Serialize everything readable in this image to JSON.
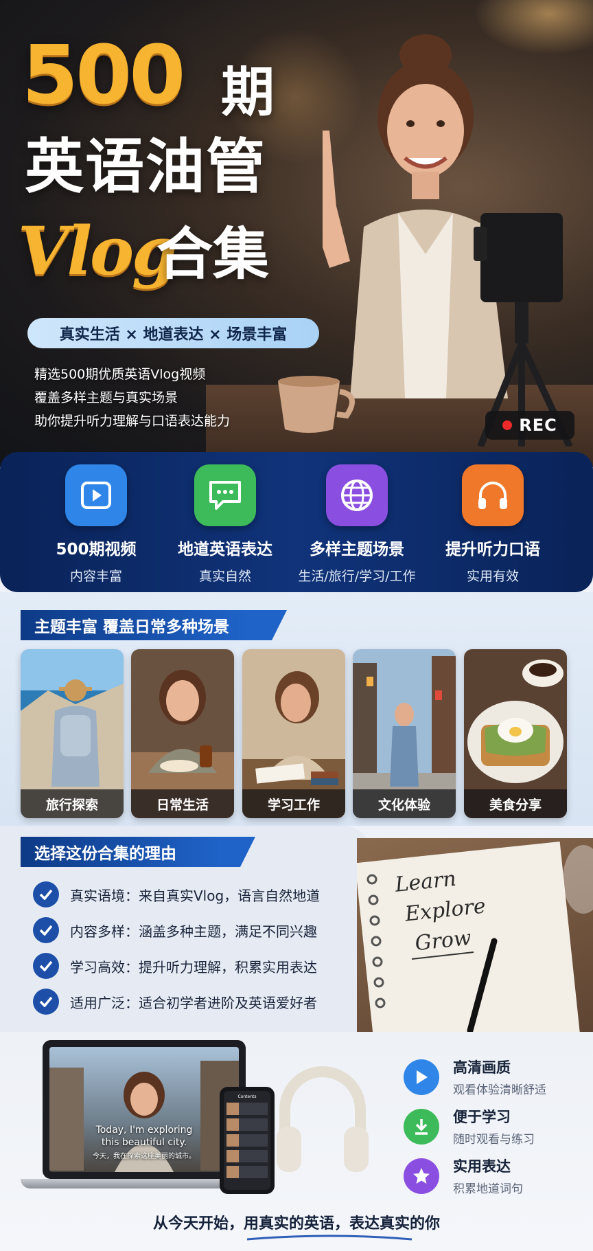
{
  "hero": {
    "title_number": "500",
    "title_unit": "期",
    "title_line2": "英语油管",
    "title_vlog": "Vlog",
    "title_suffix": "合集",
    "tagline": "真实生活 × 地道表达 × 场景丰富",
    "intro": [
      "精选500期优质英语Vlog视频",
      "覆盖多样主题与真实场景",
      "助你提升听力理解与口语表达能力"
    ],
    "rec_label": "REC"
  },
  "features": [
    {
      "title": "500期视频",
      "sub": "内容丰富",
      "icon": "play-icon",
      "color": "#2f86e8"
    },
    {
      "title": "地道英语表达",
      "sub": "真实自然",
      "icon": "chat-bubble-icon",
      "color": "#3dbb5a"
    },
    {
      "title": "多样主题场景",
      "sub": "生活/旅行/学习/工作",
      "icon": "globe-icon",
      "color": "#8a4fe0"
    },
    {
      "title": "提升听力口语",
      "sub": "实用有效",
      "icon": "headphones-icon",
      "color": "#f0782a"
    }
  ],
  "themes": {
    "heading": "主题丰富 覆盖日常多种场景",
    "cards": [
      {
        "label": "旅行探索"
      },
      {
        "label": "日常生活"
      },
      {
        "label": "学习工作"
      },
      {
        "label": "文化体验"
      },
      {
        "label": "美食分享"
      }
    ]
  },
  "reasons": {
    "heading": "选择这份合集的理由",
    "items": [
      "真实语境：来自真实Vlog，语言自然地道",
      "内容多样：涵盖多种主题，满足不同兴趣",
      "学习高效：提升听力理解，积累实用表达",
      "适用广泛：适合初学者进阶及英语爱好者"
    ],
    "notebook_words": [
      "Learn",
      "Explore",
      "Grow"
    ]
  },
  "devices": {
    "subtitle_en_line1": "Today, I'm exploring",
    "subtitle_en_line2": "this beautiful city.",
    "subtitle_zh": "今天，我在探索这座美丽的城市。",
    "phone_title": "Contents"
  },
  "bullets": [
    {
      "title": "高清画质",
      "sub": "观看体验清晰舒适",
      "icon": "play-circle-icon",
      "color": "#2f86e8"
    },
    {
      "title": "便于学习",
      "sub": "随时观看与练习",
      "icon": "download-icon",
      "color": "#3dbb5a"
    },
    {
      "title": "实用表达",
      "sub": "积累地道词句",
      "icon": "star-icon",
      "color": "#8a4fe0"
    }
  ],
  "slogan": "从今天开始，用真实的英语，表达真实的你"
}
